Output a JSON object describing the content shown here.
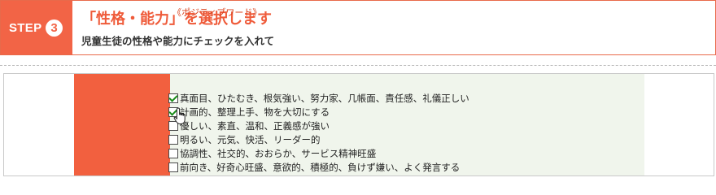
{
  "step": {
    "word": "STEP",
    "number": "3",
    "title": "「性格・能力」を選択します",
    "subtitle": "児童生徒の性格や能力にチェックを入れて"
  },
  "checklist": {
    "category": "《ポジティブワード》",
    "items": [
      {
        "label": "真面目、ひたむき、根気強い、努力家、几帳面、責任感、礼儀正しい",
        "checked": true
      },
      {
        "label": "計画的、整理上手、物を大切にする",
        "checked": true
      },
      {
        "label": "優しい、素直、温和、正義感が強い",
        "checked": false
      },
      {
        "label": "明るい、元気、快活、リーダー的",
        "checked": false
      },
      {
        "label": "協調性、社交的、おおらか、サービス精神旺盛",
        "checked": false
      },
      {
        "label": "前向き、好奇心旺盛、意欲的、積極的、負けず嫌い、よく発言する",
        "checked": false
      }
    ]
  },
  "colors": {
    "accent": "#f26446",
    "panel_green": "#f0f5ec",
    "category_text": "#d9421e"
  }
}
